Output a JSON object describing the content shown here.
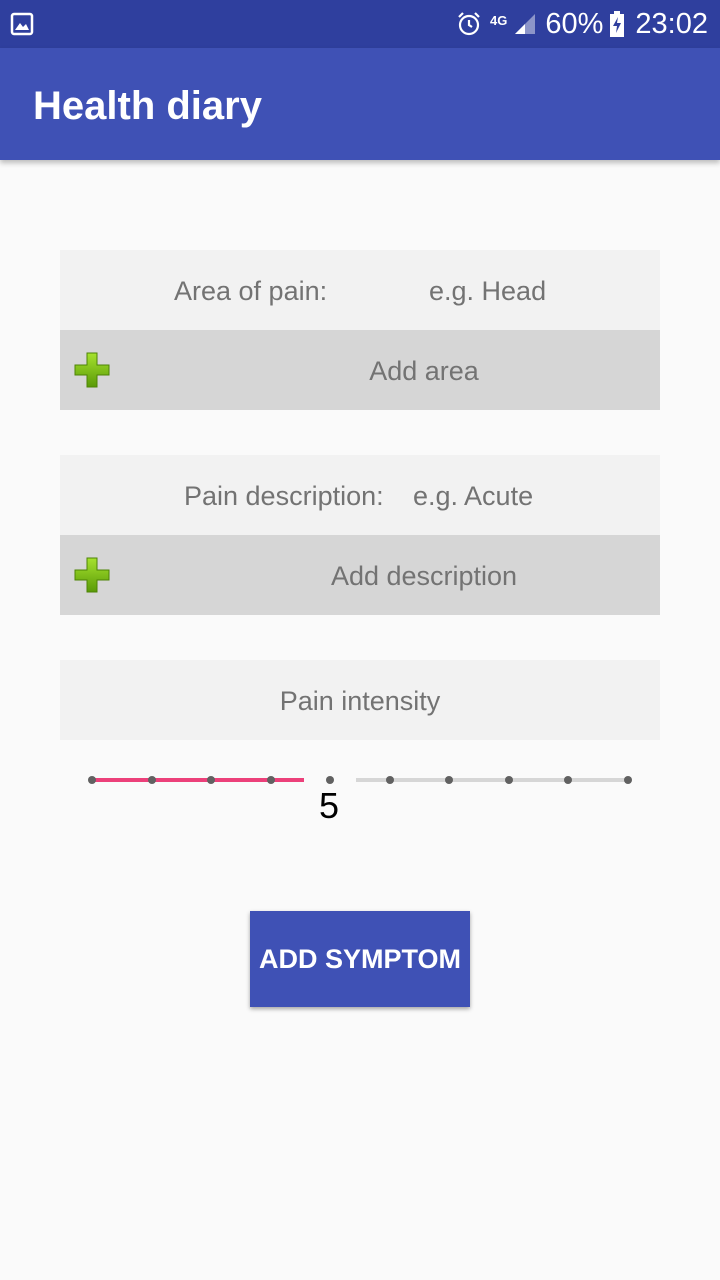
{
  "status_bar": {
    "battery_percent": "60%",
    "time": "23:02",
    "network": "4G",
    "icons": [
      "gallery-icon",
      "alarm-icon",
      "signal-icon",
      "battery-charging-icon"
    ]
  },
  "app_bar": {
    "title": "Health diary"
  },
  "area_of_pain": {
    "label": "Area of pain:",
    "placeholder": "e.g. Head",
    "add_label": "Add area"
  },
  "pain_description": {
    "label": "Pain description:",
    "placeholder": "e.g. Acute",
    "add_label": "Add description"
  },
  "pain_intensity": {
    "label": "Pain intensity",
    "value": 5,
    "min": 1,
    "max": 10,
    "value_text": "5"
  },
  "add_symptom_button": {
    "label": "ADD SYMPTOM"
  },
  "colors": {
    "primary": "#3f51b5",
    "primary_dark": "#2f3f9e",
    "accent": "#ec407a",
    "plus_icon": "#7cbb12"
  }
}
